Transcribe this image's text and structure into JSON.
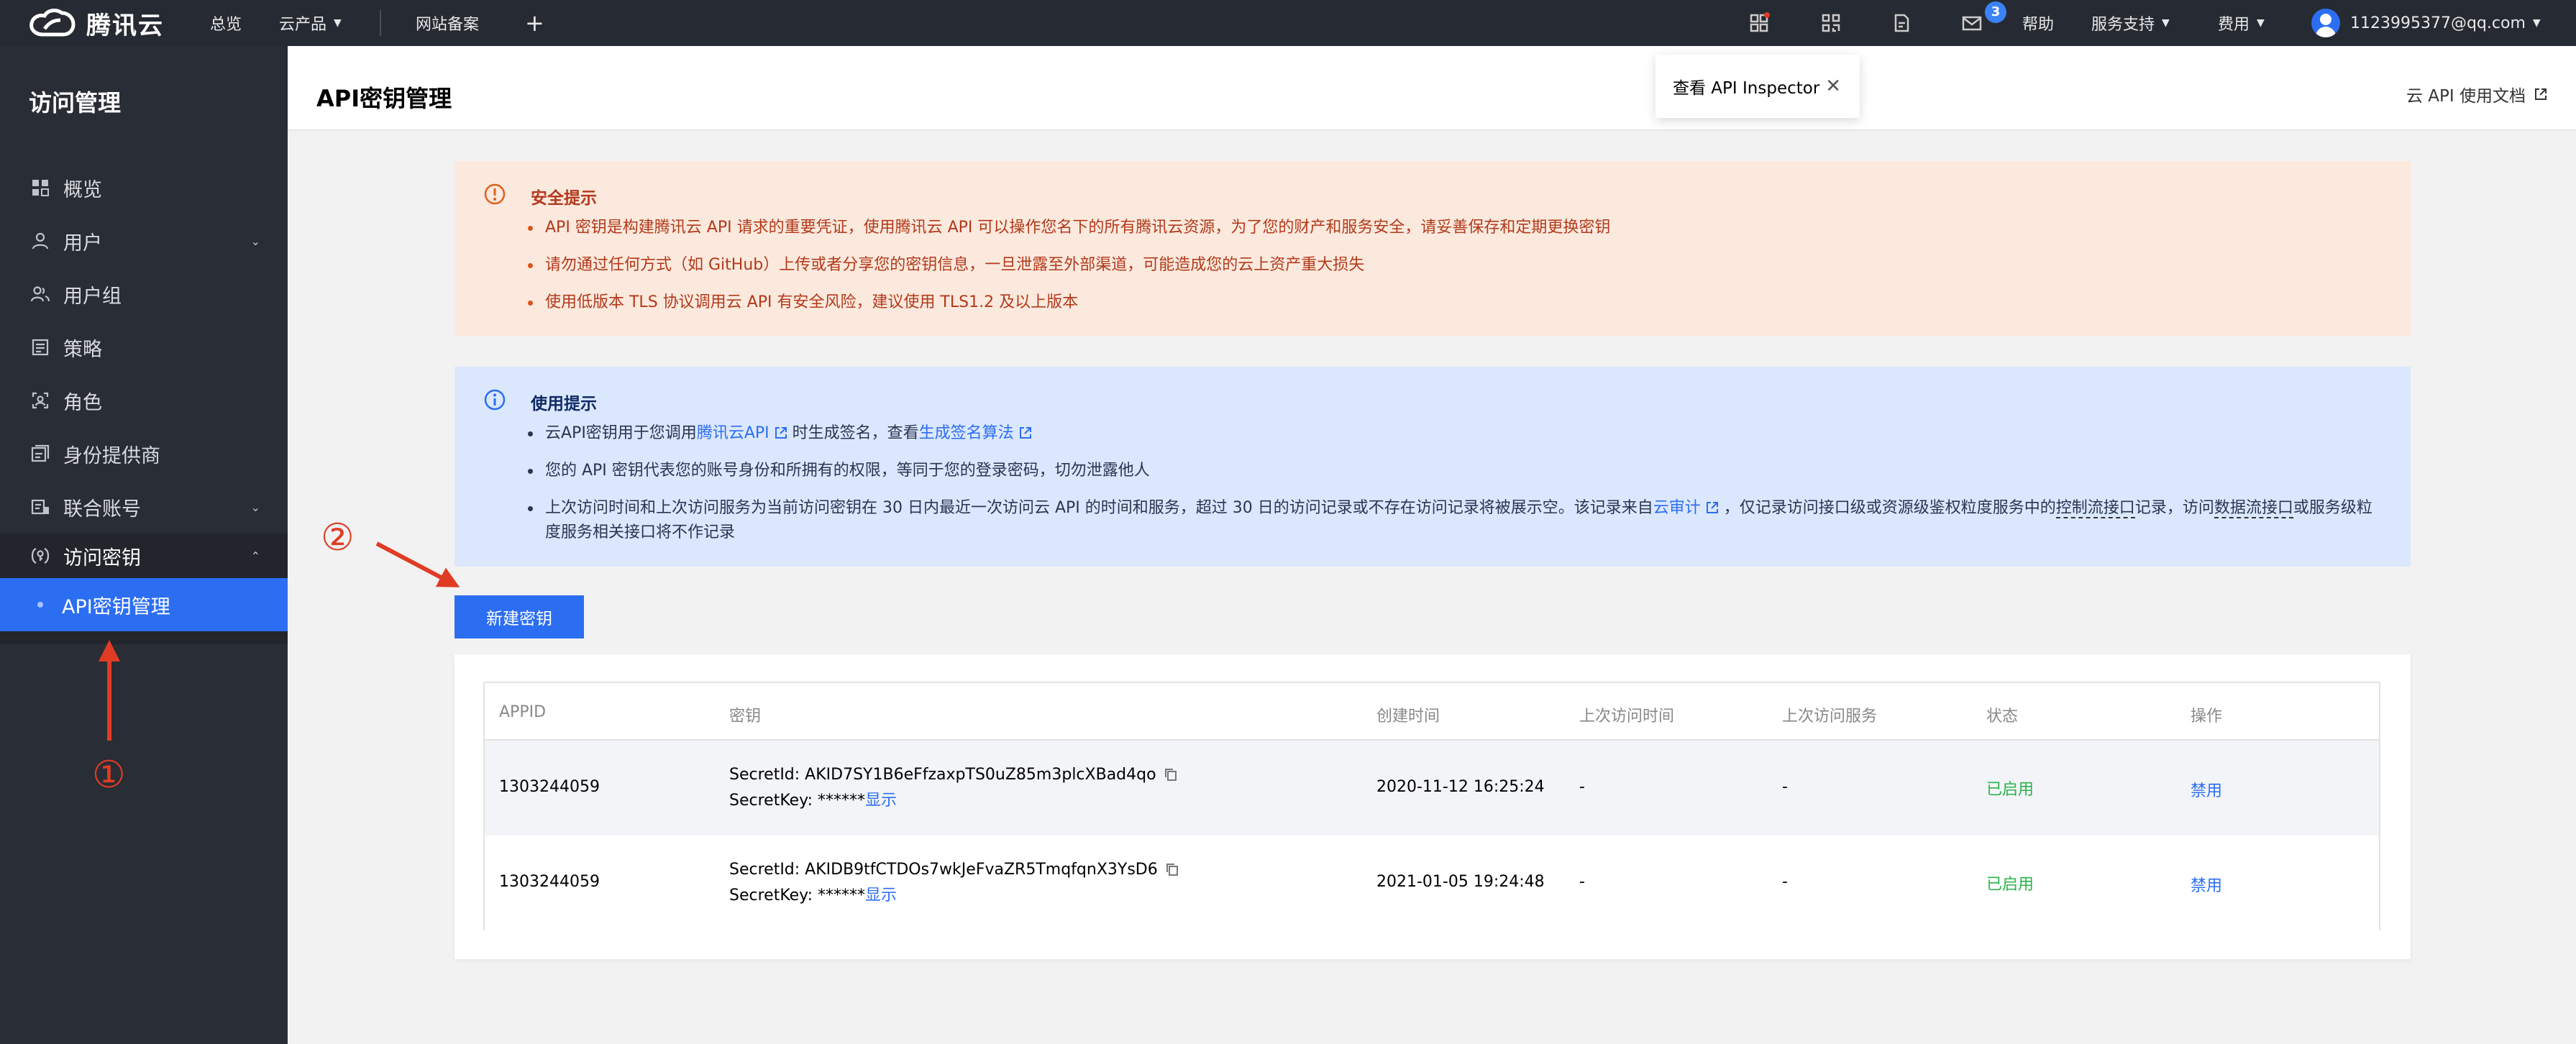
{
  "topbar": {
    "brand": "腾讯云",
    "nav": [
      {
        "label": "总览"
      },
      {
        "label": "云产品"
      },
      {
        "label": "网站备案"
      }
    ],
    "plus": "+",
    "message_count": "3",
    "help": "帮助",
    "support": "服务支持",
    "billing": "费用",
    "account": "1123995377@qq.com"
  },
  "sidebar": {
    "title": "访问管理",
    "items": [
      {
        "label": "概览",
        "icon": "grid-icon"
      },
      {
        "label": "用户",
        "icon": "user-icon"
      },
      {
        "label": "用户组",
        "icon": "users-icon"
      },
      {
        "label": "策略",
        "icon": "policy-icon"
      },
      {
        "label": "角色",
        "icon": "role-icon"
      },
      {
        "label": "身份提供商",
        "icon": "identity-icon"
      },
      {
        "label": "联合账号",
        "icon": "federation-icon"
      },
      {
        "label": "访问密钥",
        "icon": "key-icon"
      }
    ],
    "sub_item": "API密钥管理"
  },
  "header": {
    "title": "API密钥管理",
    "doc_link": "云 API 使用文档",
    "popover": "查看 API Inspector"
  },
  "warning": {
    "title": "安全提示",
    "items": [
      "API 密钥是构建腾讯云 API 请求的重要凭证，使用腾讯云 API 可以操作您名下的所有腾讯云资源，为了您的财产和服务安全，请妥善保存和定期更换密钥",
      "请勿通过任何方式（如 GitHub）上传或者分享您的密钥信息，一旦泄露至外部渠道，可能造成您的云上资产重大损失",
      "使用低版本 TLS 协议调用云 API 有安全风险，建议使用 TLS1.2 及以上版本"
    ]
  },
  "info": {
    "title": "使用提示",
    "i1_a": "云API密钥用于您调用",
    "i1_link1": "腾讯云API",
    "i1_b": "时生成签名，查看",
    "i1_link2": "生成签名算法",
    "i2": "您的 API 密钥代表您的账号身份和所拥有的权限，等同于您的登录密码，切勿泄露他人",
    "i3_a": "上次访问时间和上次访问服务为当前访问密钥在 30 日内最近一次访问云 API 的时间和服务，超过 30 日的访问记录或不存在访问记录将被展示空。该记录来自",
    "i3_link": "云审计",
    "i3_b": "，仅记录访问接口级或资源级鉴权粒度服务中的",
    "i3_dash1": "控制流接口",
    "i3_c": "记录，访问",
    "i3_dash2": "数据流接口",
    "i3_d": "或服务级粒度服务相关接口将不作记录"
  },
  "create_button": "新建密钥",
  "annotations": {
    "one": "①",
    "two": "②"
  },
  "table": {
    "headers": [
      "APPID",
      "密钥",
      "创建时间",
      "上次访问时间",
      "上次访问服务",
      "状态",
      "操作"
    ],
    "rows": [
      {
        "appid": "1303244059",
        "secret_id": "SecretId: AKID7SY1B6eFfzaxpTS0uZ85m3plcXBad4qo",
        "secret_key": "SecretKey: ******",
        "show": "显示",
        "created": "2020-11-12 16:25:24",
        "last_time": "-",
        "last_service": "-",
        "status": "已启用",
        "action": "禁用"
      },
      {
        "appid": "1303244059",
        "secret_id": "SecretId: AKIDB9tfCTDOs7wkJeFvaZR5TmqfqnX3YsD6",
        "secret_key": "SecretKey: ******",
        "show": "显示",
        "created": "2021-01-05 19:24:48",
        "last_time": "-",
        "last_service": "-",
        "status": "已启用",
        "action": "禁用"
      }
    ]
  },
  "colors": {
    "primary": "#2c6ef2",
    "sidebar_bg": "#292d35",
    "topbar_bg": "#262a32",
    "warn_bg": "#fbe9dd",
    "warn_text": "#b3391b",
    "info_bg": "#dbe7fc",
    "status_enabled": "#2bb24c",
    "annotation": "#e03c24"
  }
}
